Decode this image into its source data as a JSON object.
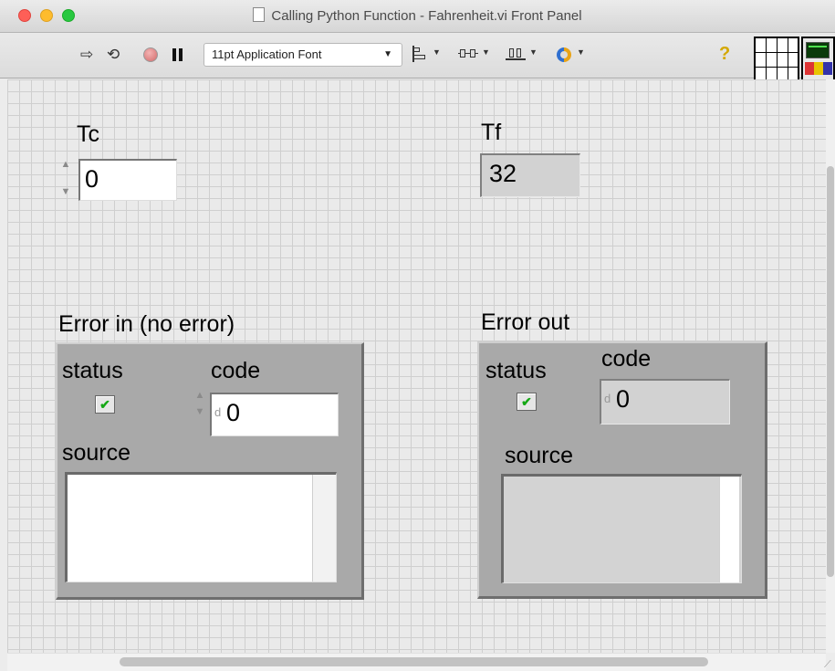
{
  "window": {
    "title": "Calling Python Function - Fahrenheit.vi Front Panel"
  },
  "traffic_lights": {
    "close_color": "#fe5f57",
    "minimize_color": "#febc2e",
    "zoom_color": "#28c840"
  },
  "toolbar": {
    "run_icon": "run-arrow-icon",
    "run_continuously_icon": "run-continuously-icon",
    "abort_icon": "abort-icon",
    "pause_icon": "pause-icon",
    "font_selector_label": "11pt Application Font",
    "align_icon": "align-objects-icon",
    "distribute_icon": "distribute-objects-icon",
    "resize_icon": "resize-objects-icon",
    "reorder_icon": "reorder-icon",
    "help_icon": "context-help-icon",
    "help_glyph": "?"
  },
  "controls": {
    "tc": {
      "label": "Tc",
      "value": "0"
    },
    "tf": {
      "label": "Tf",
      "value": "32"
    }
  },
  "error_in": {
    "label": "Error in (no error)",
    "status_label": "status",
    "status_checked": true,
    "code_label": "code",
    "code_value": "0",
    "source_label": "source",
    "source_value": ""
  },
  "error_out": {
    "label": "Error out",
    "status_label": "status",
    "status_checked": true,
    "code_label": "code",
    "code_value": "0",
    "source_label": "source",
    "source_value": ""
  },
  "glyphs": {
    "check": "✔",
    "radix": "d",
    "spin_up": "▲",
    "spin_down": "▼"
  }
}
